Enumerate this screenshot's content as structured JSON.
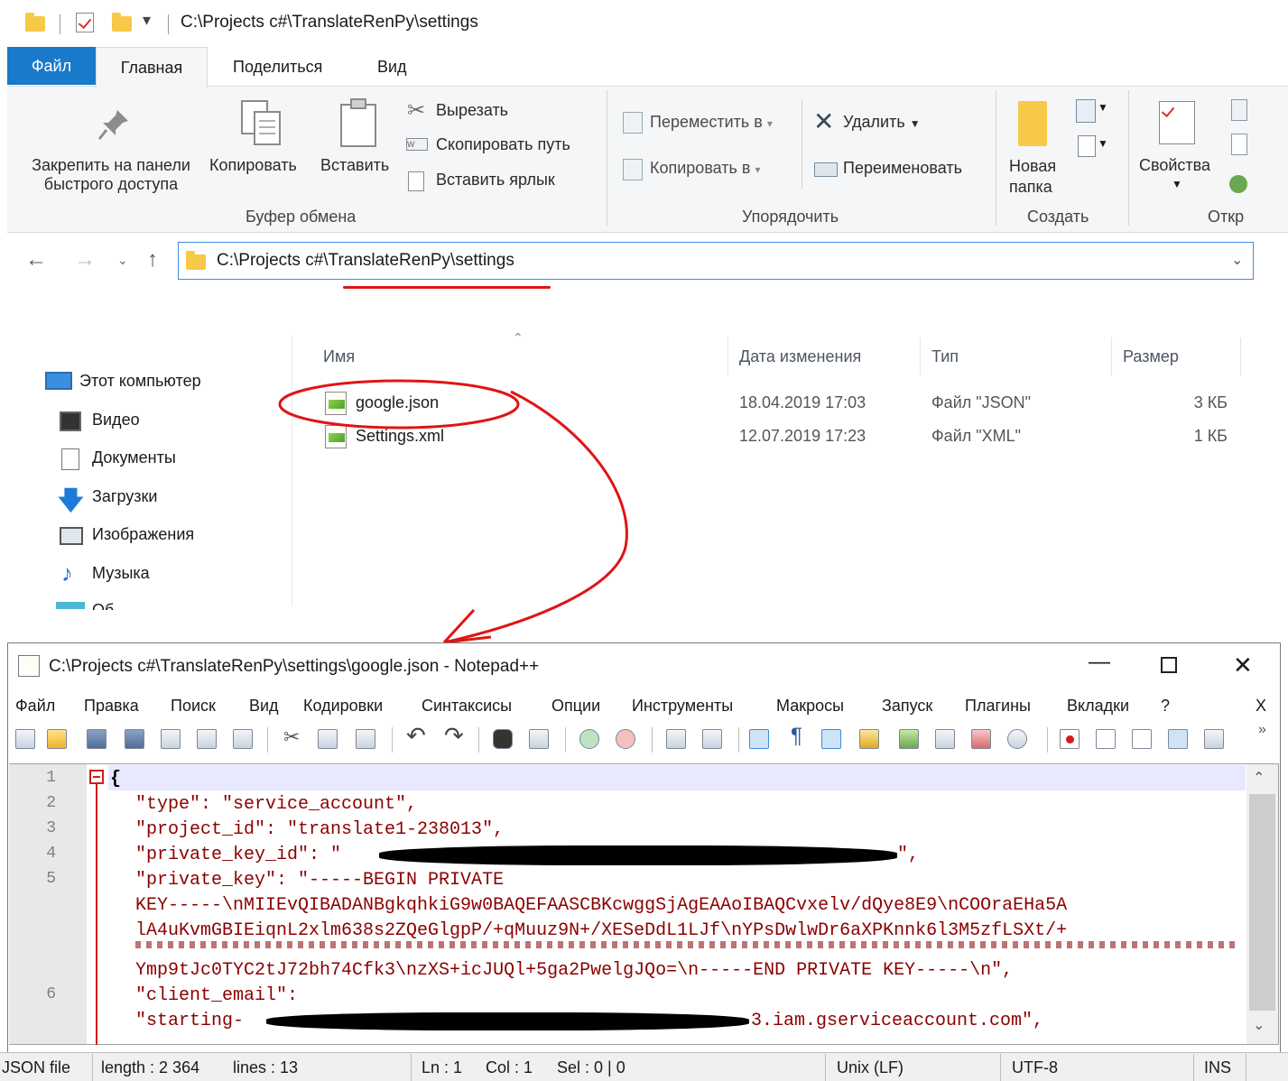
{
  "explorer": {
    "title_path": "C:\\Projects c#\\TranslateRenPy\\settings",
    "tabs": {
      "file": "Файл",
      "home": "Главная",
      "share": "Поделиться",
      "view": "Вид"
    },
    "ribbon": {
      "pin_line1": "Закрепить на панели",
      "pin_line2": "быстрого доступа",
      "copy": "Копировать",
      "paste": "Вставить",
      "cut": "Вырезать",
      "copy_path": "Скопировать путь",
      "paste_shortcut": "Вставить ярлык",
      "move_to": "Переместить в",
      "copy_to": "Копировать в",
      "delete": "Удалить",
      "rename": "Переименовать",
      "new_folder_line1": "Новая",
      "new_folder_line2": "папка",
      "properties": "Свойства",
      "group_clipboard": "Буфер обмена",
      "group_organize": "Упорядочить",
      "group_new": "Создать",
      "group_open": "Откр"
    },
    "address": "C:\\Projects c#\\TranslateRenPy\\settings",
    "nav_pane": [
      {
        "label": "Этот компьютер",
        "icon": "computer-icon"
      },
      {
        "label": "Видео",
        "icon": "video-icon"
      },
      {
        "label": "Документы",
        "icon": "documents-icon"
      },
      {
        "label": "Загрузки",
        "icon": "downloads-icon"
      },
      {
        "label": "Изображения",
        "icon": "pictures-icon"
      },
      {
        "label": "Музыка",
        "icon": "music-icon"
      },
      {
        "label": "Об",
        "icon": "objects-icon"
      }
    ],
    "columns": {
      "name": "Имя",
      "date": "Дата изменения",
      "type": "Тип",
      "size": "Размер"
    },
    "files": [
      {
        "name": "google.json",
        "date": "18.04.2019 17:03",
        "type": "Файл \"JSON\"",
        "size": "3 КБ"
      },
      {
        "name": "Settings.xml",
        "date": "12.07.2019 17:23",
        "type": "Файл \"XML\"",
        "size": "1 КБ"
      }
    ]
  },
  "notepad": {
    "title": "C:\\Projects c#\\TranslateRenPy\\settings\\google.json - Notepad++",
    "menu": {
      "file": "Файл",
      "edit": "Правка",
      "search": "Поиск",
      "view": "Вид",
      "encoding": "Кодировки",
      "syntax": "Синтаксисы",
      "options": "Опции",
      "tools": "Инструменты",
      "macros": "Макросы",
      "run": "Запуск",
      "plugins": "Плагины",
      "tabs": "Вкладки",
      "help": "?",
      "close": "X"
    },
    "lines": {
      "l1": "{",
      "l2": "\"type\": \"service_account\",",
      "l3": "\"project_id\": \"translate1-238013\",",
      "l4a": "\"private_key_id\": \"",
      "l4b": "\",",
      "l5a": "\"private_key\": \"-----BEGIN PRIVATE",
      "l5b": "KEY-----\\nMIIEvQIBADANBgkqhkiG9w0BAQEFAASCBKcwggSjAgEAAoIBAQCvxelv/dQye8E9\\nCOOraEHa5A",
      "l5c": "lA4uKvmGBIEiqnL2xlm638s2ZQeGlgpP/+qMuuz9N+/XESeDdL1LJf\\nYPsDwlwDr6aXPKnnk6l3M5zfLSXt/+",
      "l5d": "Ymp9tJc0TYC2tJ72bh74Cfk3\\nzXS+icJUQl+5ga2PwelgJQo=\\n-----END PRIVATE KEY-----\\n\",",
      "l6a": "\"client_email\":",
      "l6b_start": "\"starting-",
      "l6b_end": "3.iam.gserviceaccount.com\","
    },
    "line_numbers": [
      "1",
      "2",
      "3",
      "4",
      "5",
      "6"
    ],
    "status": {
      "file_type": "JSON file",
      "length": "length : 2 364",
      "lines": "lines : 13",
      "ln": "Ln : 1",
      "col": "Col : 1",
      "sel": "Sel : 0 | 0",
      "eol": "Unix (LF)",
      "encoding": "UTF-8",
      "mode": "INS"
    }
  },
  "colors": {
    "accent_blue": "#1979ca",
    "annotation_red": "#e01414",
    "code_string": "#8b0000"
  }
}
